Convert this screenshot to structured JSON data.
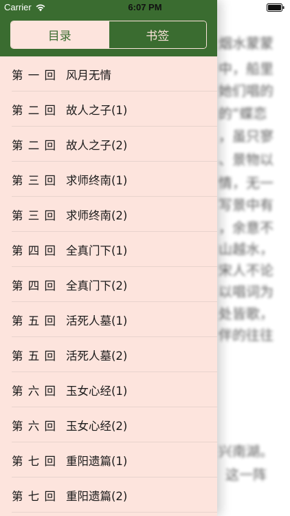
{
  "status": {
    "carrier": "Carrier",
    "time": "6:07 PM"
  },
  "tabs": {
    "toc": "目录",
    "bookmarks": "书签"
  },
  "chapters": [
    {
      "num": "第 一 回",
      "title": "风月无情"
    },
    {
      "num": "第 二 回",
      "title": "故人之子(1)"
    },
    {
      "num": "第 二 回",
      "title": "故人之子(2)"
    },
    {
      "num": "第 三 回",
      "title": "求师终南(1)"
    },
    {
      "num": "第 三 回",
      "title": "求师终南(2)"
    },
    {
      "num": "第 四 回",
      "title": "全真门下(1)"
    },
    {
      "num": "第 四 回",
      "title": "全真门下(2)"
    },
    {
      "num": "第 五 回",
      "title": "活死人墓(1)"
    },
    {
      "num": "第 五 回",
      "title": "活死人墓(2)"
    },
    {
      "num": "第 六 回",
      "title": "玉女心经(1)"
    },
    {
      "num": "第 六 回",
      "title": "玉女心经(2)"
    },
    {
      "num": "第 七 回",
      "title": "重阳遗篇(1)"
    },
    {
      "num": "第 七 回",
      "title": "重阳遗篇(2)"
    }
  ],
  "book_text": [
    "烟水蒙蒙",
    "中，船里",
    "她们唱的",
    "的“蝶恋",
    "，虽只寥",
    "、景物以",
    "情，无一",
    "写景中有",
    "，余意不",
    "山越水，",
    "宋人不论",
    "以唱词为",
    "处皆歌，",
    "伴的往往",
    "兴南湖。",
    "这一阵"
  ],
  "colors": {
    "header_green": "#3a6c30",
    "drawer_pink": "#fde4dd"
  }
}
